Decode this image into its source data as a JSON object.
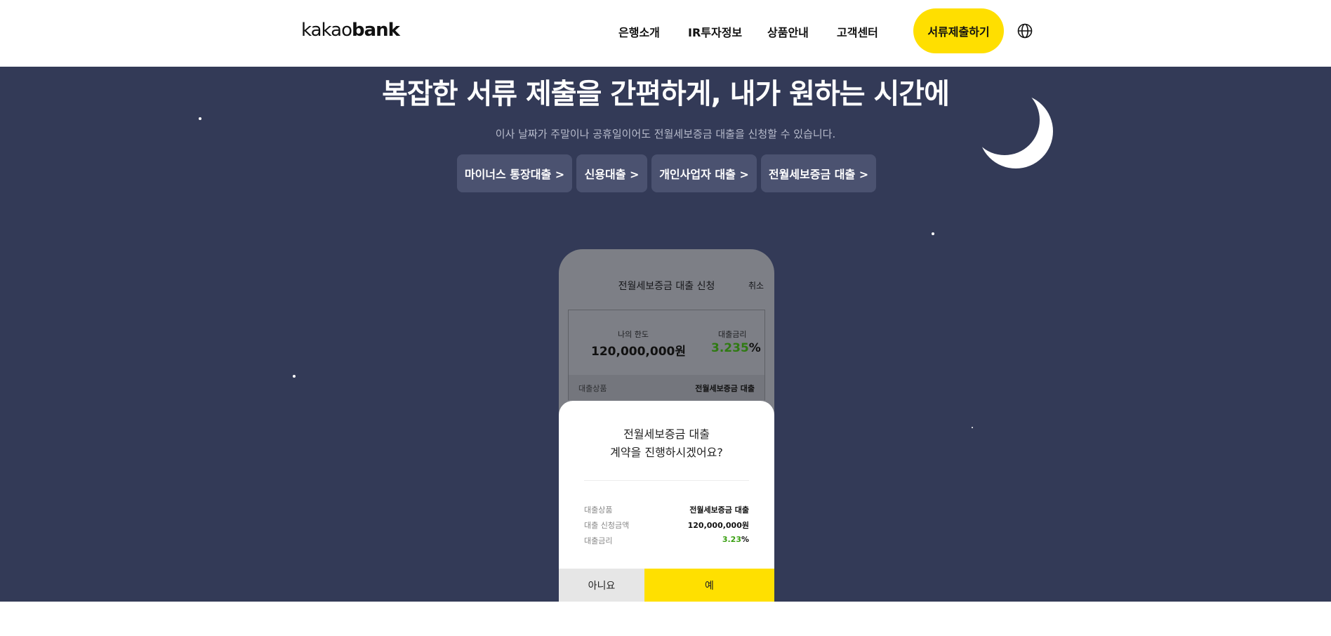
{
  "header": {
    "logo_light": "kakao",
    "logo_bold": "bank",
    "nav": [
      "은행소개",
      "IR투자정보",
      "상품안내",
      "고객센터"
    ],
    "cta_label": "서류제출하기",
    "icon": "globe-icon"
  },
  "hero": {
    "title": "복잡한 서류 제출을 간편하게, 내가 원하는 시간에",
    "subtitle": "이사 날짜가 주말이나 공휴일이어도 전월세보증금 대출을 신청할 수 있습니다.",
    "chips": [
      "마이너스 통장대출 >",
      "신용대출 >",
      "개인사업자 대출 >",
      "전월세보증금 대출 >"
    ]
  },
  "phone": {
    "title": "전월세보증금 대출 신청",
    "cancel": "취소",
    "limit_label": "나의 한도",
    "limit_value": "120,000,000원",
    "rate_label": "대출금리",
    "rate_number": "3.235",
    "rate_unit": "%",
    "product_label": "대출상품",
    "product_value": "전월세보증금 대출"
  },
  "modal": {
    "question_line1": "전월세보증금 대출",
    "question_line2": "계약을 진행하시겠어요?",
    "rows": [
      {
        "label": "대출상품",
        "value": "전월세보증금 대출"
      },
      {
        "label": "대출 신청금액",
        "value": "120,000,000원"
      },
      {
        "label": "대출금리",
        "value_number": "3.23",
        "value_unit": "%"
      }
    ],
    "no_label": "아니요",
    "yes_label": "예"
  },
  "colors": {
    "hero_bg": "#333a57",
    "accent_yellow": "#ffdf00",
    "rate_green": "#3aa012"
  }
}
